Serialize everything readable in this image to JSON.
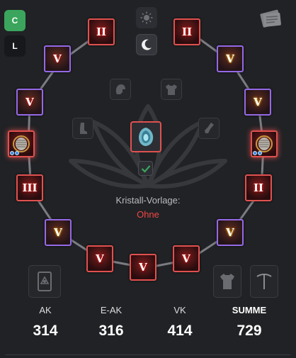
{
  "header": {
    "mode_button": "C",
    "level_button": "L"
  },
  "icons": {
    "notes": "notes-icon",
    "day": "sun-icon",
    "night": "moon-icon"
  },
  "slots_left": [
    {
      "rank": "II",
      "frame": "red"
    },
    {
      "rank": "V",
      "frame": "purple"
    },
    {
      "rank": "V",
      "frame": "purple"
    },
    {
      "rank": "",
      "frame": "red",
      "sockets": 2
    },
    {
      "rank": "III",
      "frame": "red"
    },
    {
      "rank": "V",
      "frame": "purple"
    },
    {
      "rank": "V",
      "frame": "red"
    },
    {
      "rank": "V",
      "frame": "red"
    }
  ],
  "slots_right": [
    {
      "rank": "II",
      "frame": "red"
    },
    {
      "rank": "V",
      "frame": "purple"
    },
    {
      "rank": "V",
      "frame": "purple"
    },
    {
      "rank": "",
      "frame": "red",
      "sockets": 2
    },
    {
      "rank": "II",
      "frame": "red"
    },
    {
      "rank": "V",
      "frame": "purple"
    },
    {
      "rank": "V",
      "frame": "red"
    }
  ],
  "crystal": {
    "label": "Kristall-Vorlage:",
    "value": "Ohne",
    "accent": "#f04747"
  },
  "colors": {
    "red_frame": "#e0514f",
    "purple_frame": "#9569e6",
    "c_button": "#3ba55d"
  },
  "stats": [
    {
      "label": "AK",
      "value": "314"
    },
    {
      "label": "E-AK",
      "value": "316"
    },
    {
      "label": "VK",
      "value": "414"
    },
    {
      "label": "SUMME",
      "value": "729"
    }
  ]
}
